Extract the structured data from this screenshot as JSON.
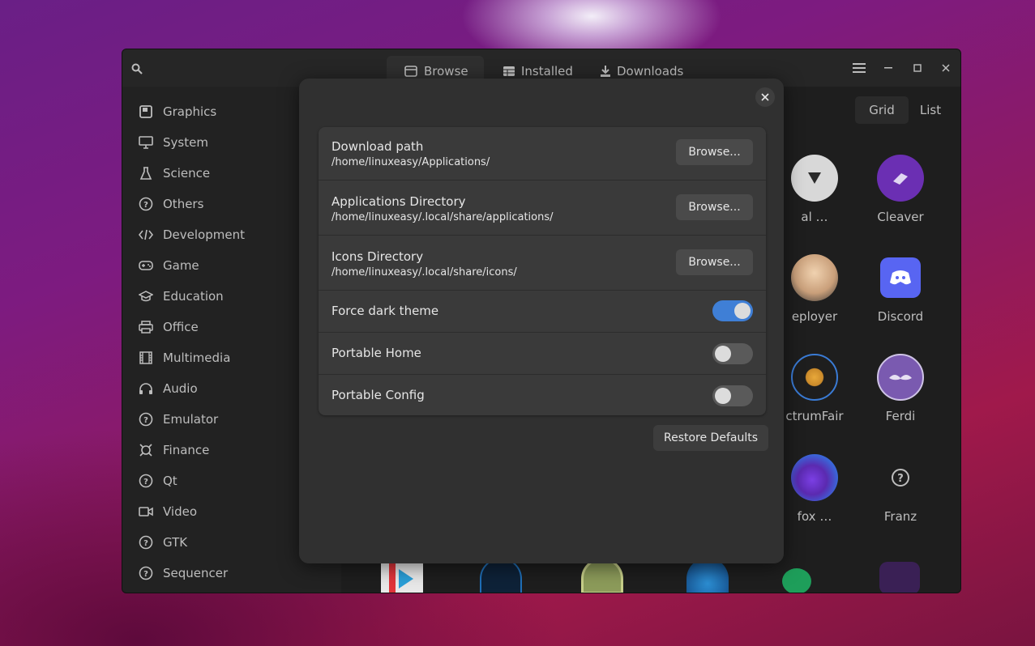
{
  "header": {
    "tabs": [
      {
        "label": "Browse",
        "icon": "browse-icon"
      },
      {
        "label": "Installed",
        "icon": "installed-icon"
      },
      {
        "label": "Downloads",
        "icon": "download-icon"
      }
    ]
  },
  "sidebar": {
    "items": [
      {
        "label": "Graphics",
        "icon": "graphics-icon"
      },
      {
        "label": "System",
        "icon": "monitor-icon"
      },
      {
        "label": "Science",
        "icon": "flask-icon"
      },
      {
        "label": "Others",
        "icon": "question-icon"
      },
      {
        "label": "Development",
        "icon": "code-icon"
      },
      {
        "label": "Game",
        "icon": "gamepad-icon"
      },
      {
        "label": "Education",
        "icon": "graduation-cap-icon"
      },
      {
        "label": "Office",
        "icon": "printer-icon"
      },
      {
        "label": "Multimedia",
        "icon": "film-icon"
      },
      {
        "label": "Audio",
        "icon": "headphones-icon"
      },
      {
        "label": "Emulator",
        "icon": "question-icon"
      },
      {
        "label": "Finance",
        "icon": "finance-icon"
      },
      {
        "label": "Qt",
        "icon": "question-icon"
      },
      {
        "label": "Video",
        "icon": "video-camera-icon"
      },
      {
        "label": "GTK",
        "icon": "question-icon"
      },
      {
        "label": "Sequencer",
        "icon": "question-icon"
      }
    ]
  },
  "view": {
    "grid_label": "Grid",
    "list_label": "List"
  },
  "apps": [
    {
      "name": "al …",
      "icon": "triangle-app-icon"
    },
    {
      "name": "Cleaver",
      "icon": "cleaver-icon"
    },
    {
      "name": "eployer",
      "icon": "jenkins-icon"
    },
    {
      "name": "Discord",
      "icon": "discord-icon"
    },
    {
      "name": "ctrumFair",
      "icon": "spectrumfair-icon"
    },
    {
      "name": "Ferdi",
      "icon": "ferdi-icon"
    },
    {
      "name": "fox …",
      "icon": "firefox-icon"
    },
    {
      "name": "Franz",
      "icon": "question-icon"
    }
  ],
  "dialog": {
    "rows": [
      {
        "title": "Download path",
        "subtitle": "/home/linuxeasy/Applications/",
        "button": "Browse..."
      },
      {
        "title": "Applications Directory",
        "subtitle": "/home/linuxeasy/.local/share/applications/",
        "button": "Browse..."
      },
      {
        "title": "Icons Directory",
        "subtitle": "/home/linuxeasy/.local/share/icons/",
        "button": "Browse..."
      }
    ],
    "toggles": [
      {
        "title": "Force dark theme",
        "on": true
      },
      {
        "title": "Portable Home",
        "on": false
      },
      {
        "title": "Portable Config",
        "on": false
      }
    ],
    "restore_label": "Restore Defaults"
  },
  "colors": {
    "accent": "#3f7fd6",
    "switch_off": "#5a5a5a"
  }
}
